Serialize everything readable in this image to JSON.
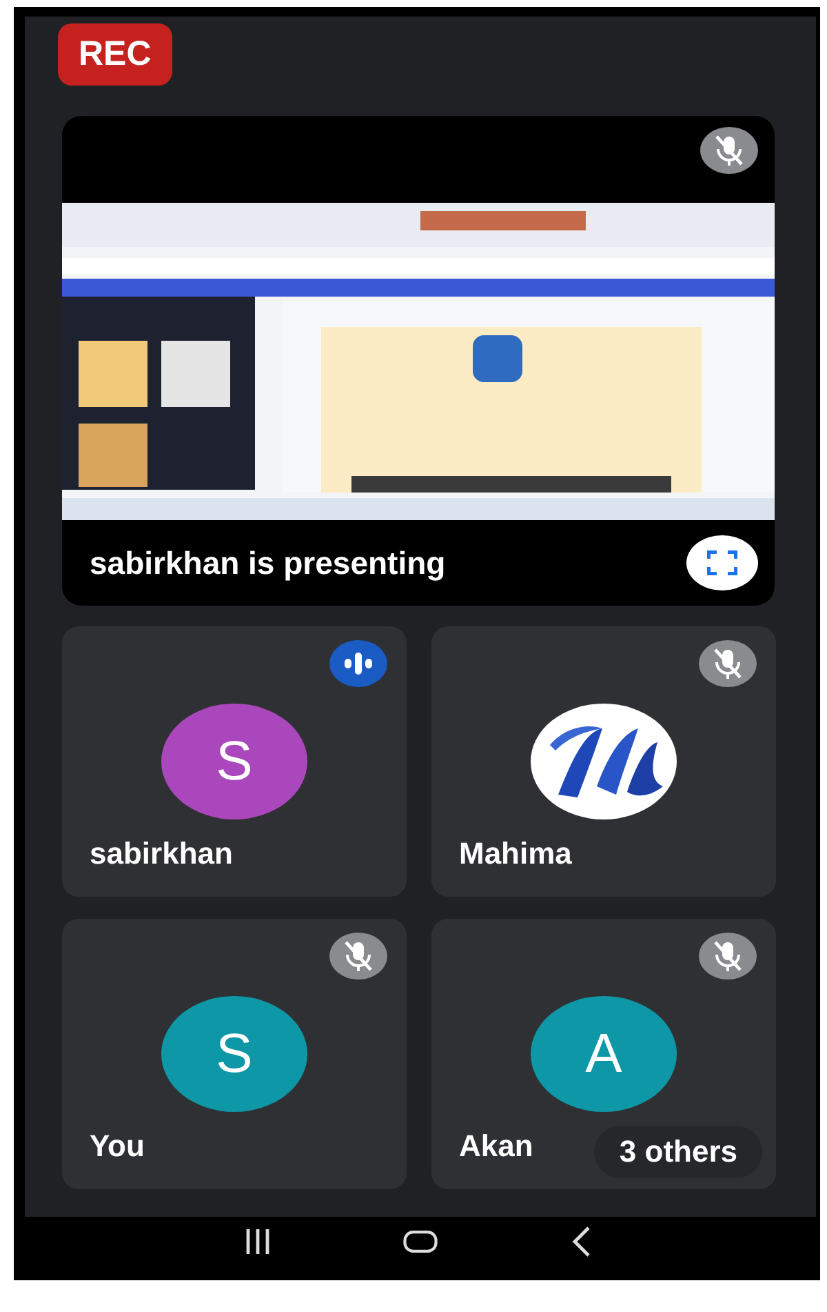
{
  "recording": {
    "label": "REC"
  },
  "presentation": {
    "presenter_text": "sabirkhan is presenting",
    "muted": true
  },
  "tiles": [
    {
      "name": "sabirkhan",
      "muted": false,
      "speaking": true,
      "avatar": {
        "kind": "initial",
        "initial": "S",
        "color": "#ab47bc"
      }
    },
    {
      "name": "Mahima",
      "muted": true,
      "speaking": false
    },
    {
      "name": "You",
      "muted": true,
      "speaking": false,
      "avatar": {
        "kind": "initial",
        "initial": "S",
        "color": "#0e97a6"
      }
    },
    {
      "name": "Akan",
      "muted": true,
      "speaking": false,
      "avatar": {
        "kind": "initial",
        "initial": "A",
        "color": "#0e97a6"
      },
      "overlay_chip": "3 others"
    }
  ]
}
